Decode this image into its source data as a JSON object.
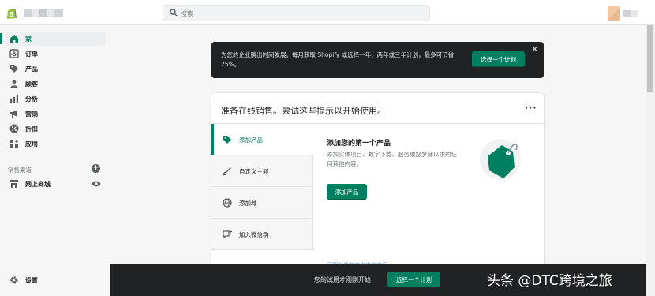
{
  "search": {
    "placeholder": "搜索"
  },
  "sidebar": {
    "items": [
      {
        "label": "家",
        "icon": "home-icon",
        "active": true
      },
      {
        "label": "订单",
        "icon": "orders-icon"
      },
      {
        "label": "产品",
        "icon": "tag-icon"
      },
      {
        "label": "顾客",
        "icon": "person-icon"
      },
      {
        "label": "分析",
        "icon": "bar-chart-icon"
      },
      {
        "label": "营销",
        "icon": "megaphone-icon"
      },
      {
        "label": "折扣",
        "icon": "discount-icon"
      },
      {
        "label": "应用",
        "icon": "apps-icon"
      }
    ],
    "channels_label": "销售渠道",
    "channel": {
      "label": "网上商城",
      "icon": "store-icon"
    },
    "settings": {
      "label": "设置",
      "icon": "gear-icon"
    }
  },
  "banner": {
    "text": "为您的企业腾出时间发展。每月获取 Shopify 或选择一年、两年或三年计划，最多可节省 25%。",
    "button": "选择一个计划"
  },
  "setup_card": {
    "title": "准备在线销售。尝试这些提示以开始使用。",
    "menu": "···",
    "tasks": [
      {
        "label": "添加产品",
        "icon": "tag-icon",
        "active": true
      },
      {
        "label": "自定义主题",
        "icon": "brush-icon"
      },
      {
        "label": "添加域",
        "icon": "globe-icon"
      },
      {
        "label": "加入微信群",
        "icon": "chat-add-icon"
      }
    ],
    "detail_title": "添加您的第一个产品",
    "detail_body": "添加实体项目、数字下载、服务或您梦寐以求的任何其他内容。",
    "detail_button": "添加产品",
    "faded_link": "了解有关在商店中的产品"
  },
  "trial_bar": {
    "text": "您的试用才刚刚开始",
    "button": "选择一个计划"
  },
  "watermark": "头条 @DTC跨境之旅",
  "colors": {
    "accent": "#008060",
    "dark": "#202223"
  }
}
